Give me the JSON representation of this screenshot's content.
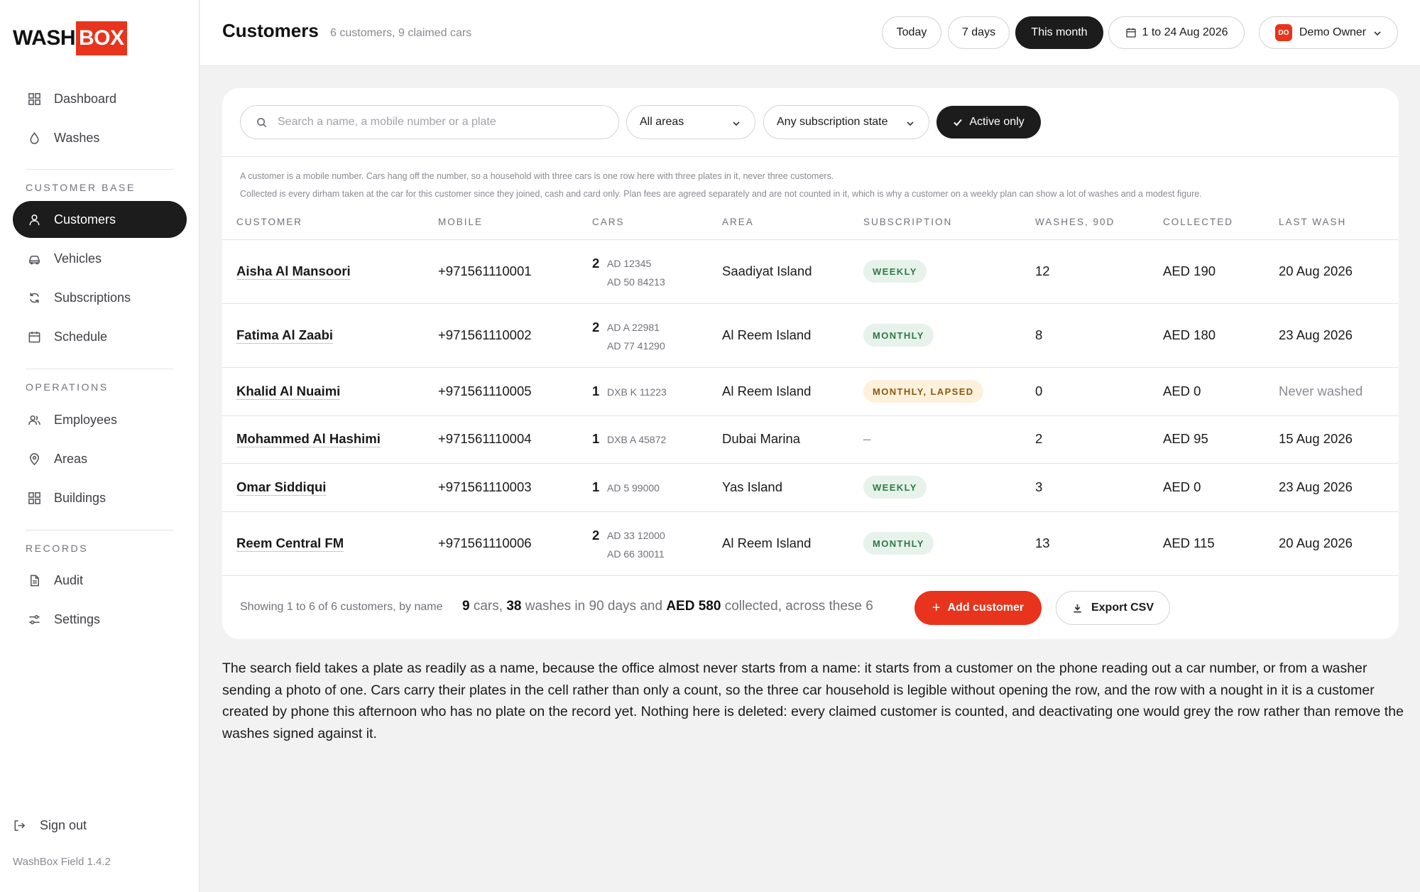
{
  "brand": {
    "wash": "WASH",
    "box": "BOX",
    "accent": "#e8341c"
  },
  "sidebar": {
    "primary": [
      {
        "label": "Dashboard",
        "icon": "grid-icon"
      },
      {
        "label": "Washes",
        "icon": "droplet-icon"
      }
    ],
    "sections": [
      {
        "title": "CUSTOMER BASE",
        "items": [
          {
            "label": "Customers",
            "icon": "user-icon",
            "active": true
          },
          {
            "label": "Vehicles",
            "icon": "car-icon"
          },
          {
            "label": "Subscriptions",
            "icon": "refresh-icon"
          },
          {
            "label": "Schedule",
            "icon": "calendar-icon"
          }
        ]
      },
      {
        "title": "OPERATIONS",
        "items": [
          {
            "label": "Employees",
            "icon": "users-icon"
          },
          {
            "label": "Areas",
            "icon": "map-pin-icon"
          },
          {
            "label": "Buildings",
            "icon": "grid-icon"
          }
        ]
      },
      {
        "title": "RECORDS",
        "items": [
          {
            "label": "Audit",
            "icon": "file-icon"
          },
          {
            "label": "Settings",
            "icon": "sliders-icon"
          }
        ]
      }
    ],
    "signout": "Sign out",
    "version": "WashBox Field 1.4.2"
  },
  "header": {
    "title": "Customers",
    "subtitle": "6 customers, 9 claimed cars",
    "ranges": [
      "Today",
      "7 days",
      "This month"
    ],
    "active_range": "This month",
    "date_range": "1 to 24 Aug 2026",
    "user_initials": "DO",
    "user_name": "Demo Owner"
  },
  "filters": {
    "search_placeholder": "Search a name, a mobile number or a plate",
    "area": "All areas",
    "subscription": "Any subscription state",
    "active_toggle": "Active only"
  },
  "notes": [
    "A customer is a mobile number. Cars hang off the number, so a household with three cars is one row here with three plates in it, never three customers.",
    "Collected is every dirham taken at the car for this customer since they joined, cash and card only. Plan fees are agreed separately and are not counted in it, which is why a customer on a weekly plan can show a lot of washes and a modest figure."
  ],
  "table": {
    "columns": [
      "CUSTOMER",
      "MOBILE",
      "CARS",
      "AREA",
      "SUBSCRIPTION",
      "WASHES, 90D",
      "COLLECTED",
      "LAST WASH"
    ],
    "rows": [
      {
        "name": "Aisha Al Mansoori",
        "mobile": "+971561110001",
        "cars": "2",
        "plates": [
          "AD 12345",
          "AD 50 84213"
        ],
        "area": "Saadiyat Island",
        "subscription": "WEEKLY",
        "sub_style": "green",
        "washes": "12",
        "collected": "AED 190",
        "last": "20 Aug 2026"
      },
      {
        "name": "Fatima Al Zaabi",
        "mobile": "+971561110002",
        "cars": "2",
        "plates": [
          "AD A 22981",
          "AD 77 41290"
        ],
        "area": "Al Reem Island",
        "subscription": "MONTHLY",
        "sub_style": "green",
        "washes": "8",
        "collected": "AED 180",
        "last": "23 Aug 2026"
      },
      {
        "name": "Khalid Al Nuaimi",
        "mobile": "+971561110005",
        "cars": "1",
        "plates": [
          "DXB K 11223"
        ],
        "area": "Al Reem Island",
        "subscription": "MONTHLY, LAPSED",
        "sub_style": "amber",
        "washes": "0",
        "collected": "AED 0",
        "last": "Never washed",
        "last_muted": true
      },
      {
        "name": "Mohammed Al Hashimi",
        "mobile": "+971561110004",
        "cars": "1",
        "plates": [
          "DXB A 45872"
        ],
        "area": "Dubai Marina",
        "subscription": "–",
        "sub_style": "none",
        "washes": "2",
        "collected": "AED 95",
        "last": "15 Aug 2026"
      },
      {
        "name": "Omar Siddiqui",
        "mobile": "+971561110003",
        "cars": "1",
        "plates": [
          "AD 5 99000"
        ],
        "area": "Yas Island",
        "subscription": "WEEKLY",
        "sub_style": "green",
        "washes": "3",
        "collected": "AED 0",
        "last": "23 Aug 2026"
      },
      {
        "name": "Reem Central FM",
        "mobile": "+971561110006",
        "cars": "2",
        "plates": [
          "AD 33 12000",
          "AD 66 30011"
        ],
        "area": "Al Reem Island",
        "subscription": "MONTHLY",
        "sub_style": "green",
        "washes": "13",
        "collected": "AED 115",
        "last": "20 Aug 2026"
      }
    ]
  },
  "footer": {
    "showing": "Showing 1 to 6 of 6 customers, by name",
    "cars_count": "9",
    "cars_word": " cars, ",
    "washes_count": "38",
    "washes_word": " washes in 90 days and ",
    "collected_total": "AED 580",
    "collected_word": " collected, across these 6",
    "add_label": "Add customer",
    "export_label": "Export CSV"
  },
  "description": "The search field takes a plate as readily as a name, because the office almost never starts from a name: it starts from a customer on the phone reading out a car number, or from a washer sending a photo of one. Cars carry their plates in the cell rather than only a count, so the three car household is legible without opening the row, and the row with a nought in it is a customer created by phone this afternoon who has no plate on the record yet. Nothing here is deleted: every claimed customer is counted, and deactivating one would grey the row rather than remove the washes signed against it."
}
